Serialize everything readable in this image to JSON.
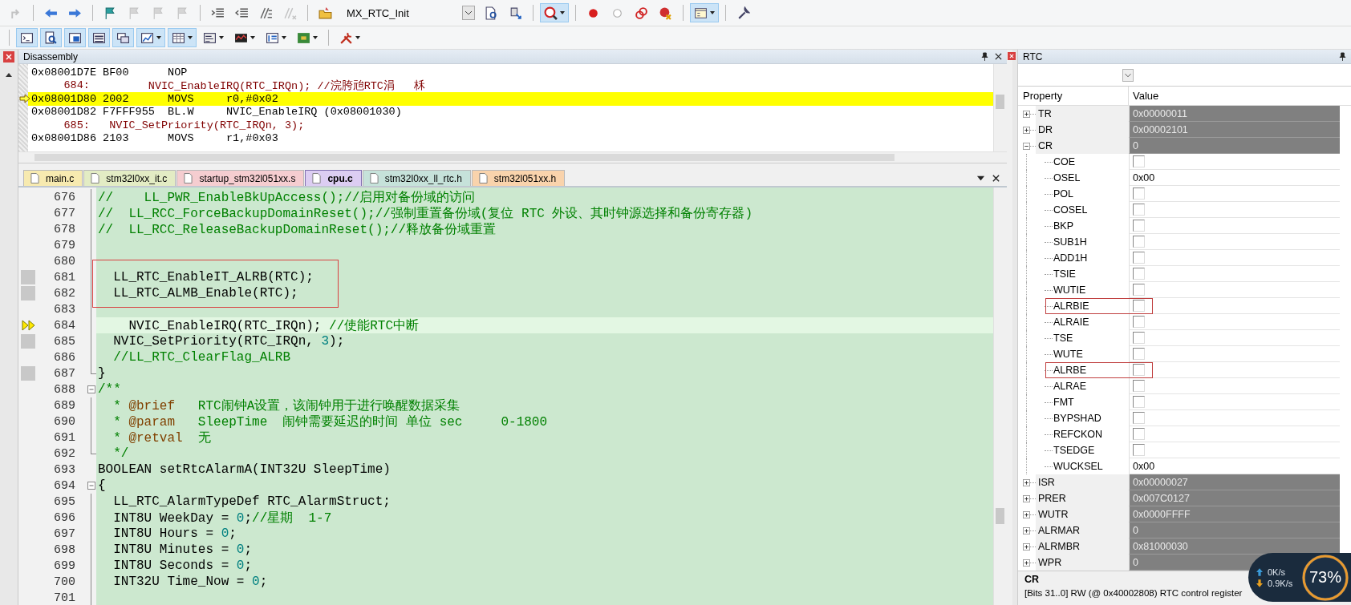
{
  "toolbars": [
    [
      {
        "kind": "button",
        "pressed": false,
        "disabled": true,
        "dropdown": false
      },
      {
        "kind": "separator"
      },
      {
        "kind": "button",
        "pressed": false,
        "disabled": false,
        "dropdown": false
      },
      {
        "kind": "button",
        "pressed": false,
        "disabled": false,
        "dropdown": false
      },
      {
        "kind": "separator"
      },
      {
        "kind": "button",
        "pressed": false,
        "disabled": false,
        "dropdown": false
      },
      {
        "kind": "button",
        "pressed": false,
        "disabled": true,
        "dropdown": false
      },
      {
        "kind": "button",
        "pressed": false,
        "disabled": true,
        "dropdown": false
      },
      {
        "kind": "button",
        "pressed": false,
        "disabled": true,
        "dropdown": false
      },
      {
        "kind": "separator"
      },
      {
        "kind": "button",
        "pressed": false,
        "disabled": false,
        "dropdown": false
      },
      {
        "kind": "button",
        "pressed": false,
        "disabled": false,
        "dropdown": false
      },
      {
        "kind": "button",
        "pressed": false,
        "disabled": false,
        "dropdown": false
      },
      {
        "kind": "button",
        "pressed": false,
        "disabled": true,
        "dropdown": false
      },
      {
        "kind": "separator"
      },
      {
        "kind": "button",
        "pressed": false,
        "disabled": false,
        "dropdown": false
      },
      {
        "kind": "combo",
        "value": "MX_RTC_Init"
      },
      {
        "kind": "button",
        "pressed": false,
        "disabled": false,
        "dropdown": false
      },
      {
        "kind": "button",
        "pressed": false,
        "disabled": false,
        "dropdown": false
      },
      {
        "kind": "separator"
      },
      {
        "kind": "button",
        "pressed": true,
        "disabled": false,
        "dropdown": true
      },
      {
        "kind": "separator"
      },
      {
        "kind": "button",
        "pressed": false,
        "disabled": false,
        "dropdown": false
      },
      {
        "kind": "button",
        "pressed": false,
        "disabled": false,
        "dropdown": false
      },
      {
        "kind": "button",
        "pressed": false,
        "disabled": false,
        "dropdown": false
      },
      {
        "kind": "button",
        "pressed": false,
        "disabled": false,
        "dropdown": false
      },
      {
        "kind": "separator"
      },
      {
        "kind": "button",
        "pressed": true,
        "disabled": false,
        "dropdown": true
      },
      {
        "kind": "separator"
      },
      {
        "kind": "button",
        "pressed": false,
        "disabled": false,
        "dropdown": false
      }
    ],
    [
      {
        "kind": "separator"
      },
      {
        "kind": "button",
        "pressed": true,
        "disabled": false,
        "dropdown": false
      },
      {
        "kind": "button",
        "pressed": true,
        "disabled": false,
        "dropdown": false
      },
      {
        "kind": "button",
        "pressed": true,
        "disabled": false,
        "dropdown": false
      },
      {
        "kind": "button",
        "pressed": true,
        "disabled": false,
        "dropdown": false
      },
      {
        "kind": "button",
        "pressed": true,
        "disabled": false,
        "dropdown": false
      },
      {
        "kind": "button",
        "pressed": true,
        "disabled": false,
        "dropdown": true
      },
      {
        "kind": "button",
        "pressed": true,
        "disabled": false,
        "dropdown": true
      },
      {
        "kind": "button",
        "pressed": false,
        "disabled": false,
        "dropdown": true
      },
      {
        "kind": "button",
        "pressed": false,
        "disabled": false,
        "dropdown": true
      },
      {
        "kind": "button",
        "pressed": false,
        "disabled": false,
        "dropdown": true
      },
      {
        "kind": "button",
        "pressed": false,
        "disabled": false,
        "dropdown": true
      },
      {
        "kind": "separator"
      },
      {
        "kind": "button",
        "pressed": false,
        "disabled": false,
        "dropdown": true
      }
    ]
  ],
  "disassembly": {
    "title": "Disassembly",
    "lines": [
      {
        "kind": "asm",
        "address": "0x08001D7E",
        "opcode": "BF00",
        "mnemonic": "NOP",
        "current": false
      },
      {
        "kind": "source",
        "line": "684:",
        "text": "        NVIC_EnableIRQ(RTC_IRQn); //浣胯兘RTC涓   柇"
      },
      {
        "kind": "asm",
        "address": "0x08001D80",
        "opcode": "2002",
        "mnemonic": "MOVS",
        "operands": "r0,#0x02",
        "current": true
      },
      {
        "kind": "asm",
        "address": "0x08001D82",
        "opcode": "F7FFF955",
        "mnemonic": "BL.W",
        "operands": "NVIC_EnableIRQ (0x08001030)",
        "current": false
      },
      {
        "kind": "source",
        "line": "685:",
        "text": "  NVIC_SetPriority(RTC_IRQn, 3);"
      },
      {
        "kind": "asm",
        "address": "0x08001D86",
        "opcode": "2103",
        "mnemonic": "MOVS",
        "operands": "r1,#0x03",
        "current": false
      }
    ]
  },
  "tabs": [
    {
      "label": "main.c",
      "color": "#f7eab0",
      "selected": false
    },
    {
      "label": "stm32l0xx_it.c",
      "color": "#e3ecc4",
      "selected": false
    },
    {
      "label": "startup_stm32l051xx.s",
      "color": "#f5cdd0",
      "selected": false
    },
    {
      "label": "cpu.c",
      "color": "#dccdf2",
      "selected": true
    },
    {
      "label": "stm32l0xx_ll_rtc.h",
      "color": "#c6e2da",
      "selected": false
    },
    {
      "label": "stm32l051xx.h",
      "color": "#f9d3ac",
      "selected": false
    }
  ],
  "code": {
    "lines": [
      {
        "n": "676",
        "kind": "fold-body",
        "segments": [
          {
            "kind": "comment",
            "text": "//    LL_PWR_EnableBkUpAccess();//启用对备份域的访问"
          }
        ]
      },
      {
        "n": "677",
        "kind": "fold-body",
        "segments": [
          {
            "kind": "comment",
            "text": "//  LL_RCC_ForceBackupDomainReset();//强制重置备份域(复位 RTC 外设、其时钟源选择和备份寄存器)"
          }
        ]
      },
      {
        "n": "678",
        "kind": "fold-body",
        "segments": [
          {
            "kind": "comment",
            "text": "//  LL_RCC_ReleaseBackupDomainReset();//释放备份域重置"
          }
        ]
      },
      {
        "n": "679",
        "kind": "fold-body"
      },
      {
        "n": "680",
        "kind": "fold-body"
      },
      {
        "n": "681",
        "kind": "fold-body",
        "executable": true,
        "boxed": true,
        "segments": [
          {
            "kind": "code",
            "text": "  LL_RTC_EnableIT_ALRB(RTC);"
          }
        ]
      },
      {
        "n": "682",
        "kind": "fold-body",
        "executable": true,
        "boxed": true,
        "segments": [
          {
            "kind": "code",
            "text": "  LL_RTC_ALMB_Enable(RTC);"
          }
        ]
      },
      {
        "n": "683",
        "kind": "fold-body"
      },
      {
        "n": "684",
        "kind": "fold-body",
        "current": true,
        "segments": [
          {
            "kind": "code",
            "text": "    NVIC_EnableIRQ(RTC_IRQn); "
          },
          {
            "kind": "comment",
            "text": "//使能RTC中断"
          }
        ]
      },
      {
        "n": "685",
        "kind": "fold-body",
        "executable": true,
        "segments": [
          {
            "kind": "code",
            "text": "  NVIC_SetPriority(RTC_IRQn, "
          },
          {
            "kind": "num",
            "text": "3"
          },
          {
            "kind": "code",
            "text": ");"
          }
        ]
      },
      {
        "n": "686",
        "kind": "fold-body",
        "segments": [
          {
            "kind": "comment",
            "text": "  //LL_RTC_ClearFlag_ALRB"
          }
        ]
      },
      {
        "n": "687",
        "kind": "fold-end",
        "executable": true,
        "segments": [
          {
            "kind": "code",
            "text": "}"
          }
        ]
      },
      {
        "n": "688",
        "kind": "fold-start",
        "segments": [
          {
            "kind": "comment",
            "text": "/**"
          }
        ]
      },
      {
        "n": "689",
        "kind": "fold-body",
        "segments": [
          {
            "kind": "comment",
            "text": "  * "
          },
          {
            "kind": "tag",
            "text": "@brief"
          },
          {
            "kind": "comment",
            "text": "   RTC闹钟A设置，该闹钟用于进行唤醒数据采集"
          }
        ]
      },
      {
        "n": "690",
        "kind": "fold-body",
        "segments": [
          {
            "kind": "comment",
            "text": "  * "
          },
          {
            "kind": "tag",
            "text": "@param"
          },
          {
            "kind": "comment",
            "text": "   SleepTime  闹钟需要延迟的时间 单位 sec     0-1800"
          }
        ]
      },
      {
        "n": "691",
        "kind": "fold-body",
        "segments": [
          {
            "kind": "comment",
            "text": "  * "
          },
          {
            "kind": "tag",
            "text": "@retval"
          },
          {
            "kind": "comment",
            "text": "  无"
          }
        ]
      },
      {
        "n": "692",
        "kind": "fold-end",
        "segments": [
          {
            "kind": "comment",
            "text": "  */"
          }
        ]
      },
      {
        "n": "693",
        "kind": "plain",
        "segments": [
          {
            "kind": "code",
            "text": "BOOLEAN setRtcAlarmA(INT32U SleepTime)"
          }
        ]
      },
      {
        "n": "694",
        "kind": "fold-start",
        "segments": [
          {
            "kind": "code",
            "text": "{"
          }
        ]
      },
      {
        "n": "695",
        "kind": "fold-body",
        "segments": [
          {
            "kind": "code",
            "text": "  LL_RTC_AlarmTypeDef RTC_AlarmStruct;"
          }
        ]
      },
      {
        "n": "696",
        "kind": "fold-body",
        "segments": [
          {
            "kind": "code",
            "text": "  INT8U WeekDay = "
          },
          {
            "kind": "num",
            "text": "0"
          },
          {
            "kind": "code",
            "text": ";"
          },
          {
            "kind": "comment",
            "text": "//星期  1-7"
          }
        ]
      },
      {
        "n": "697",
        "kind": "fold-body",
        "segments": [
          {
            "kind": "code",
            "text": "  INT8U Hours = "
          },
          {
            "kind": "num",
            "text": "0"
          },
          {
            "kind": "code",
            "text": ";"
          }
        ]
      },
      {
        "n": "698",
        "kind": "fold-body",
        "segments": [
          {
            "kind": "code",
            "text": "  INT8U Minutes = "
          },
          {
            "kind": "num",
            "text": "0"
          },
          {
            "kind": "code",
            "text": ";"
          }
        ]
      },
      {
        "n": "699",
        "kind": "fold-body",
        "segments": [
          {
            "kind": "code",
            "text": "  INT8U Seconds = "
          },
          {
            "kind": "num",
            "text": "0"
          },
          {
            "kind": "code",
            "text": ";"
          }
        ]
      },
      {
        "n": "700",
        "kind": "fold-body",
        "segments": [
          {
            "kind": "code",
            "text": "  INT32U Time_Now = "
          },
          {
            "kind": "num",
            "text": "0"
          },
          {
            "kind": "code",
            "text": ";"
          }
        ]
      },
      {
        "n": "701",
        "kind": "fold-body"
      }
    ]
  },
  "rtc": {
    "title": "RTC",
    "columns": [
      "Property",
      "Value"
    ],
    "registers": [
      {
        "name": "TR",
        "value": "0x00000011",
        "expanded": false
      },
      {
        "name": "DR",
        "value": "0x00002101",
        "expanded": false
      },
      {
        "name": "CR",
        "value": "0",
        "expanded": true,
        "fields": [
          {
            "name": "COE",
            "kind": "checkbox",
            "checked": false
          },
          {
            "name": "OSEL",
            "kind": "value",
            "value": "0x00"
          },
          {
            "name": "POL",
            "kind": "checkbox",
            "checked": false
          },
          {
            "name": "COSEL",
            "kind": "checkbox",
            "checked": false
          },
          {
            "name": "BKP",
            "kind": "checkbox",
            "checked": false
          },
          {
            "name": "SUB1H",
            "kind": "checkbox",
            "checked": false
          },
          {
            "name": "ADD1H",
            "kind": "checkbox",
            "checked": false
          },
          {
            "name": "TSIE",
            "kind": "checkbox",
            "checked": false
          },
          {
            "name": "WUTIE",
            "kind": "checkbox",
            "checked": false
          },
          {
            "name": "ALRBIE",
            "kind": "checkbox",
            "checked": false,
            "marked": true
          },
          {
            "name": "ALRAIE",
            "kind": "checkbox",
            "checked": false
          },
          {
            "name": "TSE",
            "kind": "checkbox",
            "checked": false
          },
          {
            "name": "WUTE",
            "kind": "checkbox",
            "checked": false
          },
          {
            "name": "ALRBE",
            "kind": "checkbox",
            "checked": false,
            "marked": true
          },
          {
            "name": "ALRAE",
            "kind": "checkbox",
            "checked": false
          },
          {
            "name": "FMT",
            "kind": "checkbox",
            "checked": false
          },
          {
            "name": "BYPSHAD",
            "kind": "checkbox",
            "checked": false
          },
          {
            "name": "REFCKON",
            "kind": "checkbox",
            "checked": false
          },
          {
            "name": "TSEDGE",
            "kind": "checkbox",
            "checked": false
          },
          {
            "name": "WUCKSEL",
            "kind": "value",
            "value": "0x00"
          }
        ]
      },
      {
        "name": "ISR",
        "value": "0x00000027",
        "expanded": false
      },
      {
        "name": "PRER",
        "value": "0x007C0127",
        "expanded": false
      },
      {
        "name": "WUTR",
        "value": "0x0000FFFF",
        "expanded": false
      },
      {
        "name": "ALRMAR",
        "value": "0",
        "expanded": false
      },
      {
        "name": "ALRMBR",
        "value": "0x81000030",
        "expanded": false
      },
      {
        "name": "WPR",
        "value": "0",
        "expanded": false
      }
    ],
    "description": {
      "title": "CR",
      "text": "[Bits 31..0] RW (@ 0x40002808) RTC control register"
    }
  },
  "net_monitor": {
    "upload": "0K/s",
    "download": "0.9K/s",
    "percent": "73%"
  }
}
